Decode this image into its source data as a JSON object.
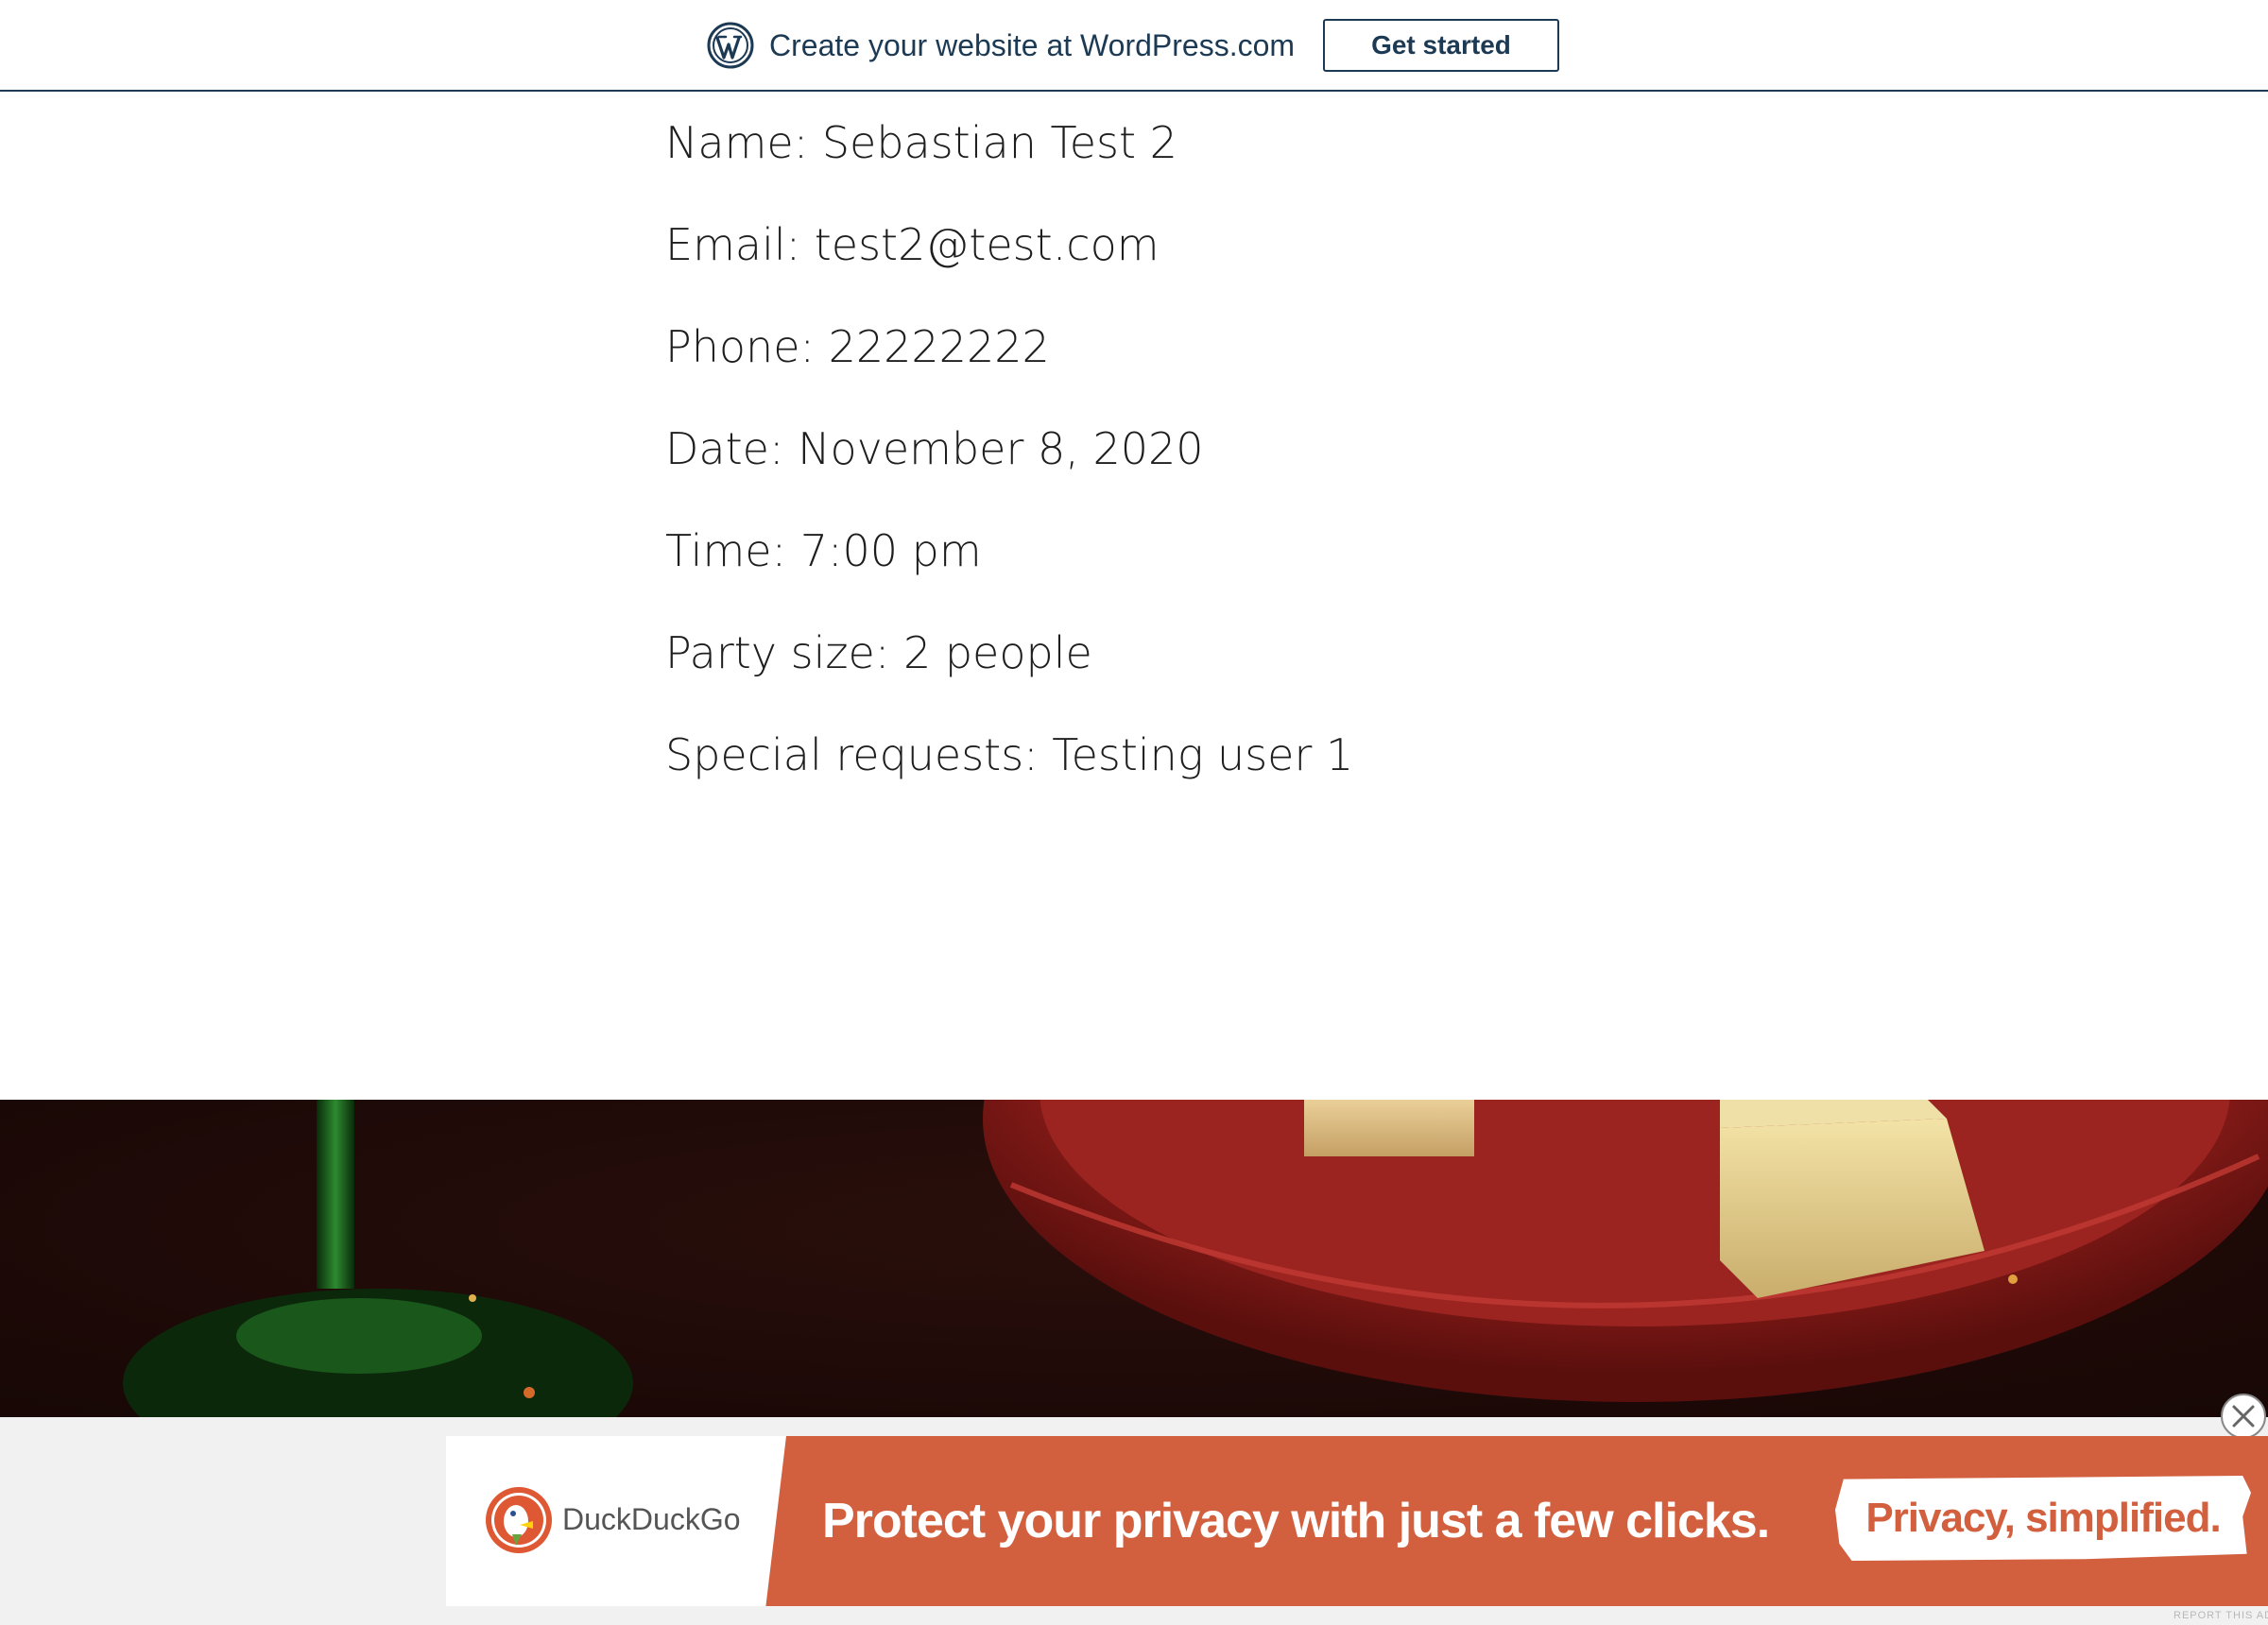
{
  "wp_banner": {
    "promo_text": "Create your website at WordPress.com",
    "cta_label": "Get started",
    "brand_color": "#1d3a55"
  },
  "reservation": {
    "name": "Name: Sebastian Test 2",
    "email": "Email: test2@test.com",
    "phone": "Phone: 22222222",
    "date": "Date: November 8, 2020",
    "time": "Time: 7:00 pm",
    "party_size": "Party size: 2 people",
    "special_requests": "Special requests: Testing user 1"
  },
  "ad": {
    "brand_name": "DuckDuckGo",
    "headline": "Protect your privacy with just a few clicks.",
    "cta": "Privacy, simplified.",
    "report_label": "REPORT THIS AD",
    "accent_color": "#d2603f"
  }
}
